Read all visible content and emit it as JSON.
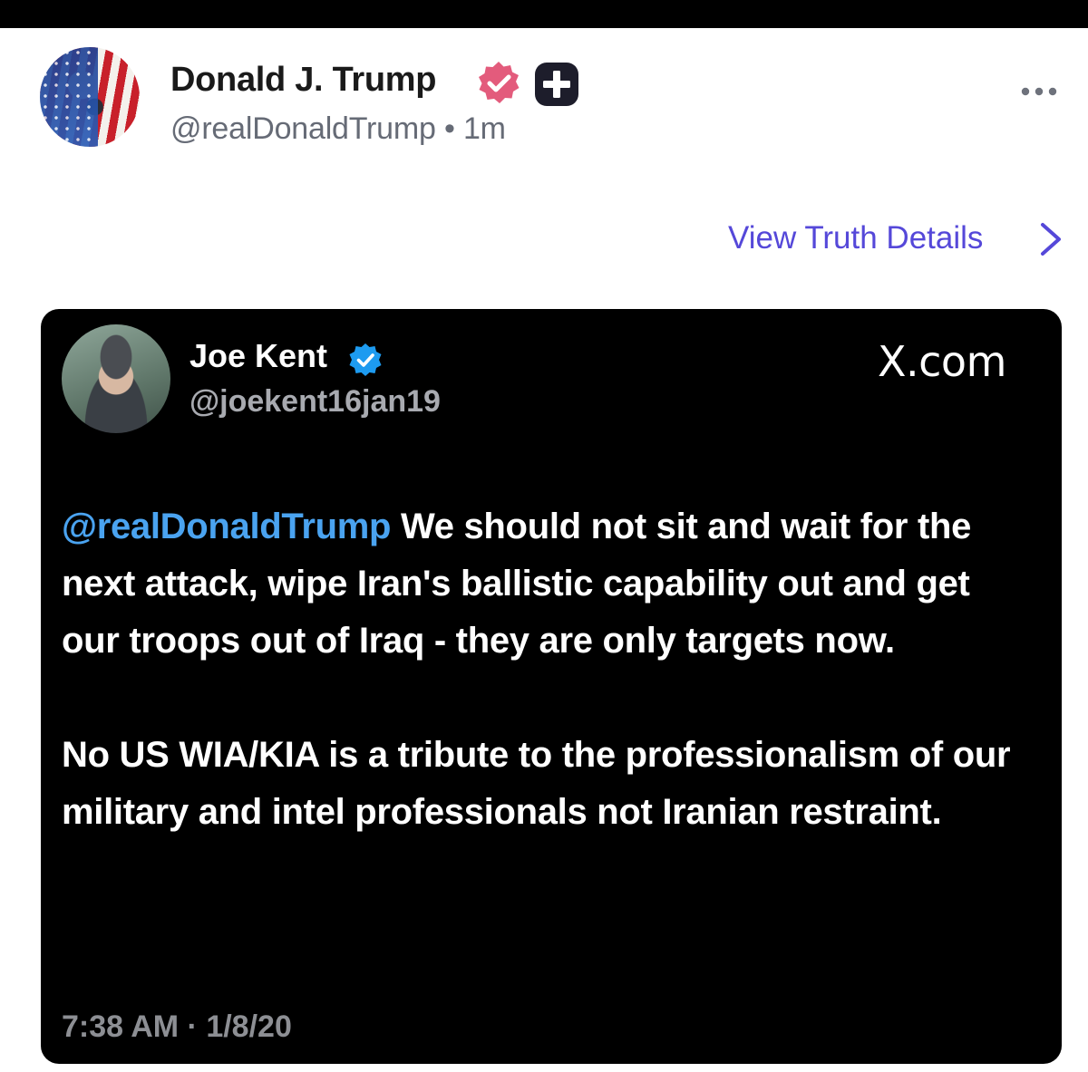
{
  "post": {
    "author_name": "Donald J. Trump",
    "author_handle": "@realDonaldTrump",
    "separator": "•",
    "time_ago": "1m",
    "view_details_label": "View Truth Details"
  },
  "embed": {
    "author_name": "Joe Kent",
    "author_handle": "@joekent16jan19",
    "source": "X.com",
    "mention": "@realDonaldTrump",
    "text_line1_rest": "We should not sit and wait for the next attack, wipe Iran's ballistic capability out and get our troops out of Iraq - they are only targets now.",
    "text_paragraph2": "No US WIA/KIA is a tribute to the professionalism of our military and intel professionals not Iranian restraint.",
    "timestamp": "7:38 AM · 1/8/20"
  },
  "colors": {
    "accent": "#5548d9",
    "verified_pink": "#e35b7c",
    "mention_blue": "#4aa3f0",
    "card_bg": "#000000"
  },
  "icons": {
    "verified": "verified-badge-icon",
    "plus": "truth-plus-icon",
    "more": "more-options-icon",
    "chevron": "chevron-right-icon",
    "embed_verified": "blue-checkmark-icon"
  }
}
